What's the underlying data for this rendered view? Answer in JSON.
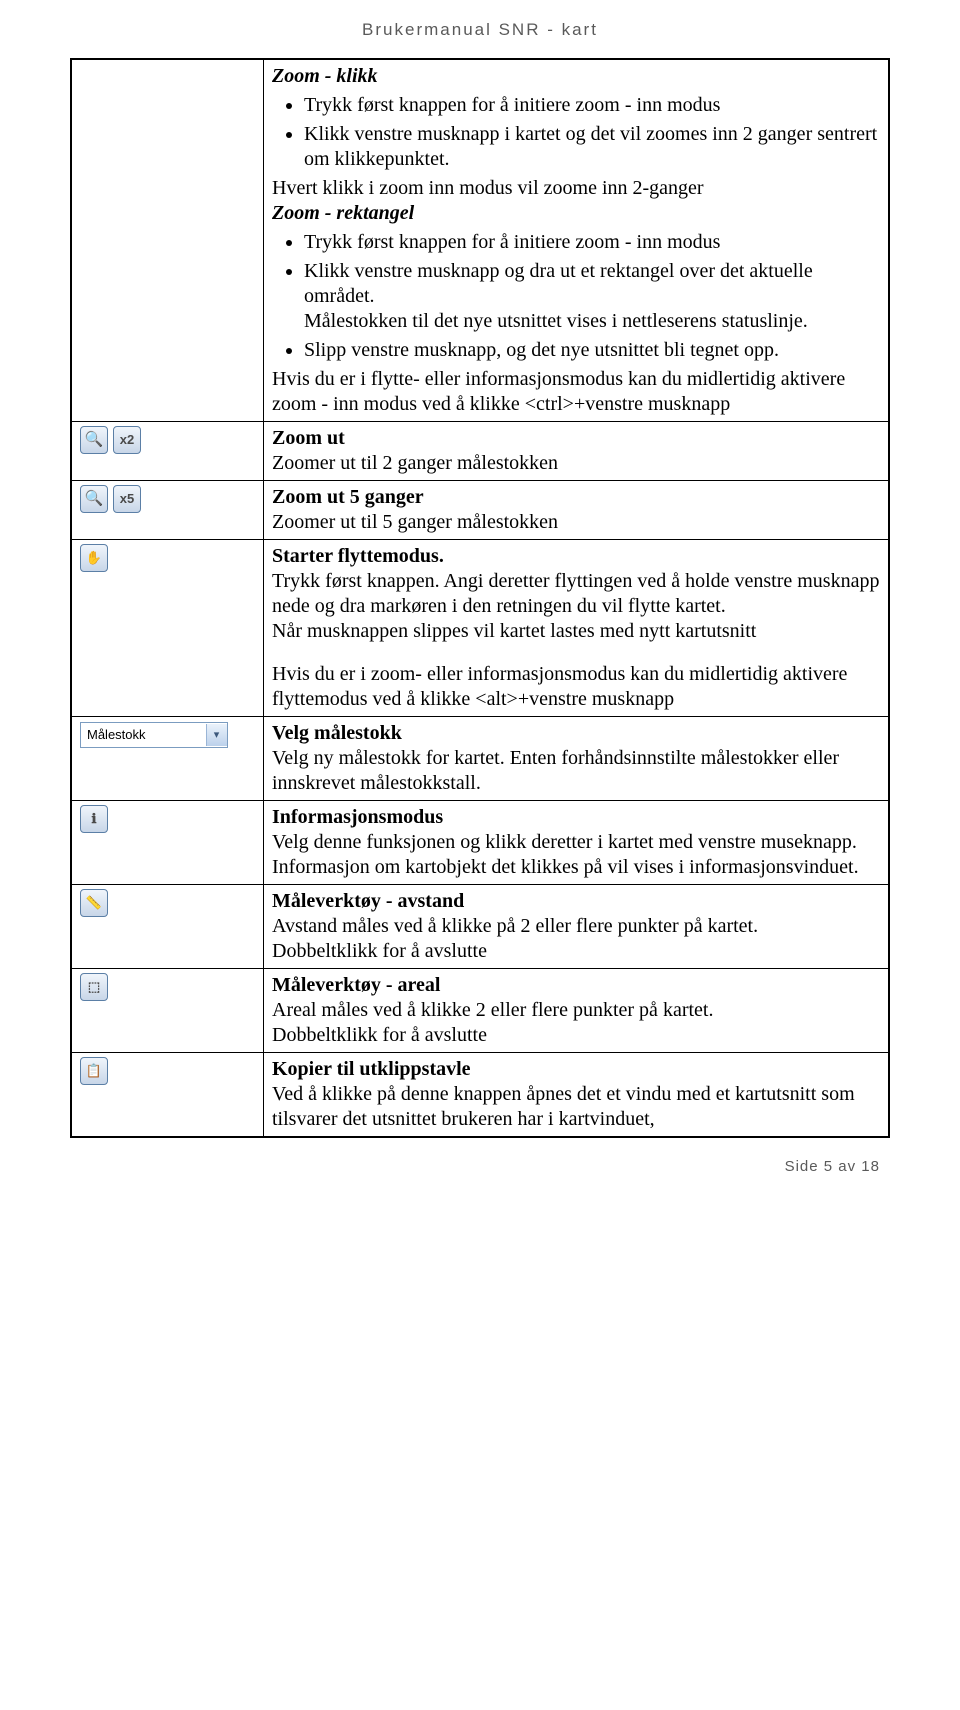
{
  "header": "Brukermanual SNR - kart",
  "footer": "Side 5 av 18",
  "dropdown_label": "Målestokk",
  "rows": {
    "zoom_klikk": {
      "title": "Zoom - klikk",
      "bullet1": "Trykk først knappen for å initiere zoom - inn modus",
      "bullet2": "Klikk venstre musknapp i kartet og det vil zoomes inn 2 ganger sentrert om klikkepunktet.",
      "after1": "Hvert klikk i zoom inn modus vil zoome inn 2-ganger",
      "title2": "Zoom - rektangel",
      "bullet3": "Trykk først knappen for å initiere zoom - inn modus",
      "bullet4": "Klikk venstre musknapp og dra ut et rektangel over det aktuelle området.",
      "bullet4b": "Målestokken til det nye utsnittet vises i nettleserens statuslinje.",
      "bullet5": "Slipp venstre musknapp, og det nye utsnittet bli tegnet opp.",
      "after2": "Hvis du er i flytte- eller informasjonsmodus kan du midlertidig aktivere zoom - inn modus ved å klikke <ctrl>+venstre musknapp"
    },
    "zoom_ut": {
      "title": "Zoom ut",
      "body": "Zoomer ut til 2 ganger målestokken"
    },
    "zoom_ut5": {
      "title": "Zoom ut 5 ganger",
      "body": "Zoomer ut til 5 ganger målestokken"
    },
    "flytte": {
      "title": "Starter flyttemodus.",
      "p1": "Trykk først knappen. Angi deretter flyttingen ved å holde venstre musknapp nede og dra markøren i den retningen du vil flytte kartet.",
      "p2": "Når musknappen slippes vil kartet lastes med nytt kartutsnitt",
      "p3": "Hvis du er i zoom- eller informasjonsmodus kan du midlertidig aktivere flyttemodus ved å klikke <alt>+venstre musknapp"
    },
    "malestokk": {
      "title": "Velg målestokk",
      "body": "Velg ny målestokk for kartet. Enten forhåndsinnstilte målestokker eller innskrevet målestokkstall."
    },
    "info": {
      "title": "Informasjonsmodus",
      "p1": "Velg denne funksjonen og klikk deretter i kartet med venstre museknapp.",
      "p2": "Informasjon om kartobjekt det klikkes på vil vises i informasjonsvinduet."
    },
    "avstand": {
      "title": "Måleverktøy - avstand",
      "p1": "Avstand måles ved å klikke på 2 eller flere punkter på kartet.",
      "p2": "Dobbeltklikk for å avslutte"
    },
    "areal": {
      "title": "Måleverktøy - areal",
      "p1": "Areal måles ved å klikke 2 eller flere punkter på kartet.",
      "p2": "Dobbeltklikk for å avslutte"
    },
    "kopier": {
      "title": "Kopier til utklippstavle",
      "body": "Ved å klikke på denne knappen åpnes det et vindu med et kartutsnitt som tilsvarer det utsnittet brukeren har i kartvinduet,"
    }
  },
  "icons": {
    "x2": "x2",
    "x5": "x5",
    "hand": "✋",
    "info": "ℹ",
    "ruler": "📏",
    "area": "⬚",
    "copy": "📋"
  }
}
